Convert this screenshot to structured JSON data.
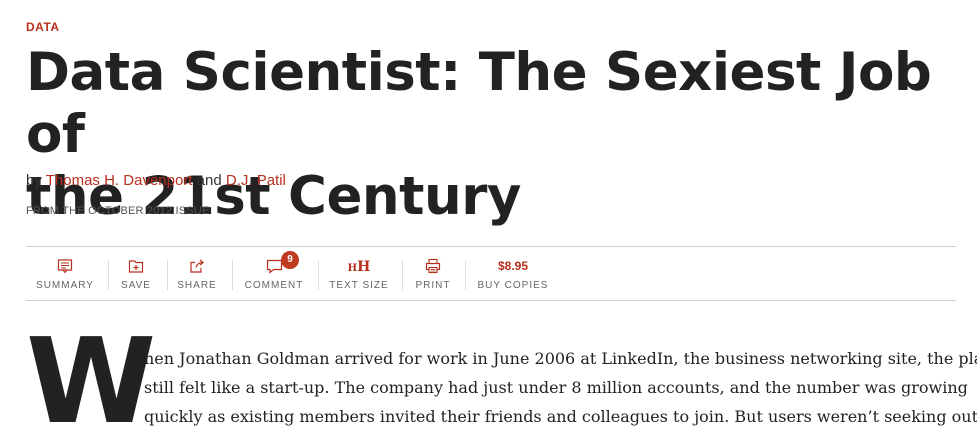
{
  "article": {
    "topic": "DATA",
    "headline_line1": "Data Scientist: The Sexiest Job of",
    "headline_line2": "the 21st Century",
    "byline_prefix": "by",
    "author1": "Thomas H. Davenport",
    "byline_and": "and",
    "author2": "D.J. Patil",
    "issue": "FROM THE OCTOBER 2012 ISSUE"
  },
  "toolbar": {
    "summary": "SUMMARY",
    "save": "SAVE",
    "share": "SHARE",
    "comment": "COMMENT",
    "comment_count": "9",
    "text_size": "TEXT SIZE",
    "print": "PRINT",
    "buy_price": "$8.95",
    "buy_copies": "BUY COPIES"
  },
  "body": {
    "dropcap": "W",
    "line1": "hen Jonathan Goldman arrived for work in June 2006 at LinkedIn, the business networking site, the place",
    "line2": "still felt like a start-up. The company had just under 8 million accounts, and the number was growing",
    "line3": "quickly as existing members invited their friends and colleagues to join. But users weren’t seeking out"
  },
  "colors": {
    "accent": "#b82f1d",
    "text": "#222222",
    "badge": "#c03a1f"
  },
  "icons": [
    "summary-icon",
    "save-icon",
    "share-icon",
    "comment-icon",
    "text-size-icon",
    "print-icon"
  ]
}
